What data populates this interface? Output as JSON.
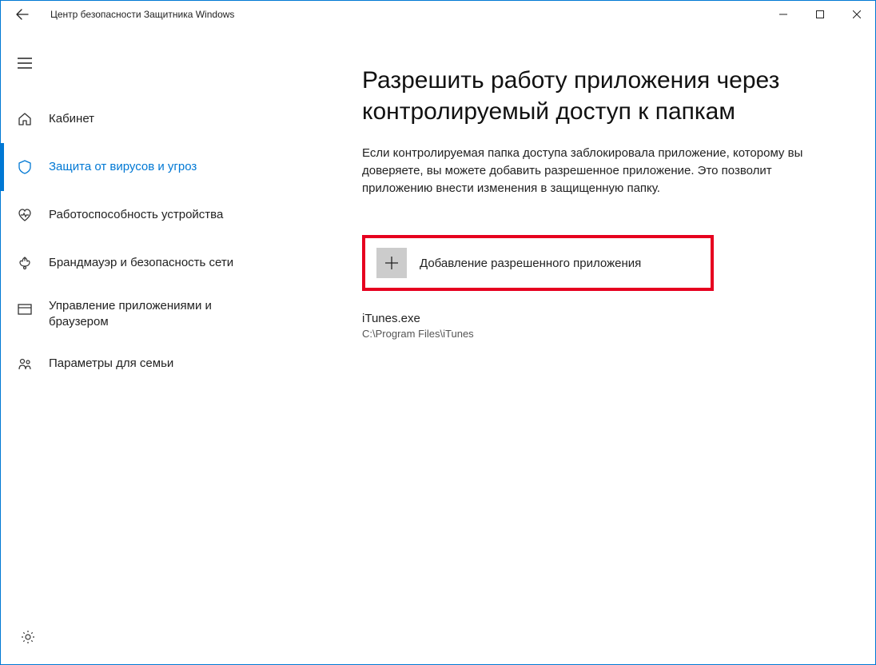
{
  "window": {
    "title": "Центр безопасности Защитника Windows"
  },
  "sidebar": {
    "items": [
      {
        "label": "Кабинет"
      },
      {
        "label": "Защита от вирусов и угроз"
      },
      {
        "label": "Работоспособность устройства"
      },
      {
        "label": "Брандмауэр и безопасность сети"
      },
      {
        "label": "Управление приложениями и браузером"
      },
      {
        "label": "Параметры для семьи"
      }
    ]
  },
  "main": {
    "title": "Разрешить работу приложения через контролируемый доступ к папкам",
    "description": "Если контролируемая папка доступа заблокировала приложение, которому вы доверяете, вы можете добавить разрешенное приложение. Это позволит приложению внести изменения в защищенную папку.",
    "add_button_label": "Добавление разрешенного приложения",
    "apps": [
      {
        "name": "iTunes.exe",
        "path": "C:\\Program Files\\iTunes"
      }
    ]
  }
}
